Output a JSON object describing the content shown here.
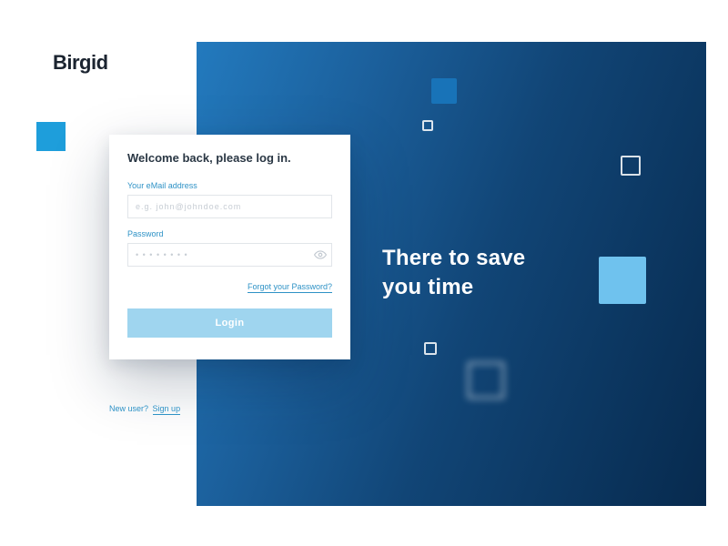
{
  "brand": {
    "name": "Birgid"
  },
  "hero": {
    "tagline_line1": "There to save",
    "tagline_line2": "you time"
  },
  "card": {
    "title": "Welcome back, please log in.",
    "email": {
      "label": "Your eMail address",
      "placeholder": "e.g. john@johndoe.com"
    },
    "password": {
      "label": "Password",
      "placeholder": "• • • • • • • •"
    },
    "forgot": "Forgot your Password?",
    "login_btn": "Login"
  },
  "signup": {
    "prompt": "New user?",
    "link": "Sign up"
  },
  "colors": {
    "accent": "#1e9edb",
    "button": "#9fd5ef",
    "hero_from": "#237abe",
    "hero_to": "#072a4e"
  }
}
